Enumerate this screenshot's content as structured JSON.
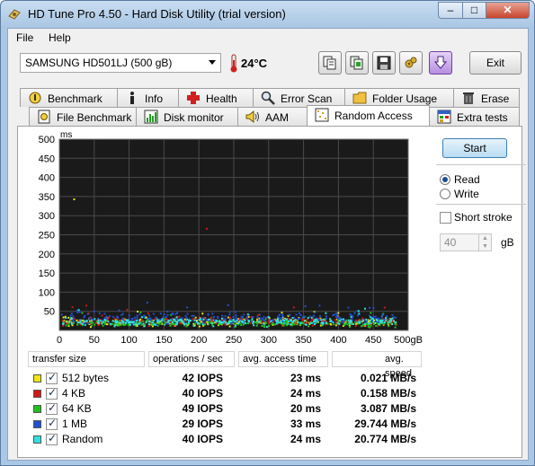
{
  "window": {
    "title": "HD Tune Pro 4.50 - Hard Disk Utility (trial version)",
    "min": "–",
    "max": "□",
    "close": "✕"
  },
  "menu": {
    "file": "File",
    "help": "Help"
  },
  "toolbar": {
    "drive": "SAMSUNG HD501LJ (500 gB)",
    "temperature": "24°C",
    "exit_label": "Exit",
    "icons": [
      "copy-icon",
      "copy-text-icon",
      "save-icon",
      "options-icon",
      "download-icon"
    ]
  },
  "tabs_top": [
    {
      "label": "Benchmark",
      "icon": "benchmark-icon"
    },
    {
      "label": "Info",
      "icon": "info-icon"
    },
    {
      "label": "Health",
      "icon": "health-icon"
    },
    {
      "label": "Error Scan",
      "icon": "error-scan-icon"
    },
    {
      "label": "Folder Usage",
      "icon": "folder-icon"
    },
    {
      "label": "Erase",
      "icon": "erase-icon"
    }
  ],
  "tabs_bottom": [
    {
      "label": "File Benchmark",
      "icon": "file-benchmark-icon"
    },
    {
      "label": "Disk monitor",
      "icon": "disk-monitor-icon"
    },
    {
      "label": "AAM",
      "icon": "speaker-icon"
    },
    {
      "label": "Random Access",
      "icon": "random-access-icon"
    },
    {
      "label": "Extra tests",
      "icon": "extra-tests-icon"
    }
  ],
  "controls": {
    "start_label": "Start",
    "read_label": "Read",
    "write_label": "Write",
    "read_selected": true,
    "short_stroke_label": "Short stroke",
    "short_stroke_checked": false,
    "stroke_value": "40",
    "stroke_unit": "gB"
  },
  "chart_data": {
    "type": "scatter",
    "ylabel": "ms",
    "xlim": [
      0,
      500
    ],
    "ylim": [
      0,
      500
    ],
    "x_ticks": [
      "0",
      "50",
      "100",
      "150",
      "200",
      "250",
      "300",
      "350",
      "400",
      "450",
      "500gB"
    ],
    "y_ticks": [
      "500",
      "450",
      "400",
      "350",
      "300",
      "250",
      "200",
      "150",
      "100",
      "50"
    ],
    "grid": true,
    "background": "#1a1a1a",
    "series": [
      {
        "name": "512 bytes",
        "color": "#f0e614",
        "avg_ms": 23
      },
      {
        "name": "4 KB",
        "color": "#d01818",
        "avg_ms": 24
      },
      {
        "name": "64 KB",
        "color": "#20c020",
        "avg_ms": 20
      },
      {
        "name": "1 MB",
        "color": "#2050d0",
        "avg_ms": 33
      },
      {
        "name": "Random",
        "color": "#30e0e0",
        "avg_ms": 24
      }
    ],
    "outliers": [
      {
        "x": 20,
        "y": 345,
        "color": "#f0e614"
      },
      {
        "x": 210,
        "y": 268,
        "color": "#d01818"
      },
      {
        "x": 465,
        "y": 62,
        "color": "#d01818"
      }
    ]
  },
  "results": {
    "headers": {
      "transfer_size": "transfer size",
      "ops": "operations / sec",
      "access": "avg. access time",
      "speed": "avg. speed"
    },
    "rows": [
      {
        "name": "512 bytes",
        "color": "#f0e614",
        "ops": "42 IOPS",
        "access": "23 ms",
        "speed": "0.021 MB/s",
        "checked": true
      },
      {
        "name": "4 KB",
        "color": "#d01818",
        "ops": "40 IOPS",
        "access": "24 ms",
        "speed": "0.158 MB/s",
        "checked": true
      },
      {
        "name": "64 KB",
        "color": "#20c020",
        "ops": "49 IOPS",
        "access": "20 ms",
        "speed": "3.087 MB/s",
        "checked": true
      },
      {
        "name": "1 MB",
        "color": "#2050d0",
        "ops": "29 IOPS",
        "access": "33 ms",
        "speed": "29.744 MB/s",
        "checked": true
      },
      {
        "name": "Random",
        "color": "#30e0e0",
        "ops": "40 IOPS",
        "access": "24 ms",
        "speed": "20.774 MB/s",
        "checked": true
      }
    ]
  }
}
